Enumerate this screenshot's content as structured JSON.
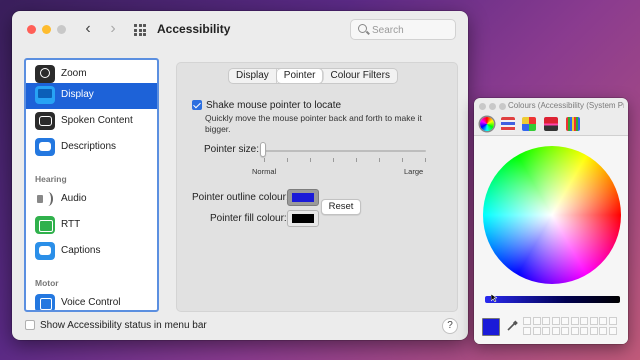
{
  "window": {
    "title": "Accessibility",
    "search_placeholder": "Search"
  },
  "sidebar": {
    "items": [
      {
        "label": "Zoom",
        "icon": "magnifier-icon"
      },
      {
        "label": "Display",
        "icon": "display-icon",
        "selected": true
      },
      {
        "label": "Spoken Content",
        "icon": "speech-bubble-icon"
      },
      {
        "label": "Descriptions",
        "icon": "descriptions-icon"
      }
    ],
    "hearing_header": "Hearing",
    "hearing_items": [
      {
        "label": "Audio",
        "icon": "speaker-icon"
      },
      {
        "label": "RTT",
        "icon": "rtt-icon"
      },
      {
        "label": "Captions",
        "icon": "captions-icon"
      }
    ],
    "motor_header": "Motor",
    "motor_items": [
      {
        "label": "Voice Control",
        "icon": "voice-control-icon"
      }
    ]
  },
  "tabs": [
    {
      "label": "Display"
    },
    {
      "label": "Pointer",
      "active": true
    },
    {
      "label": "Colour Filters"
    }
  ],
  "pointer": {
    "shake_label": "Shake mouse pointer to locate",
    "shake_checked": true,
    "shake_description": "Quickly move the mouse pointer back and forth to make it bigger.",
    "size_label": "Pointer size:",
    "size_min_label": "Normal",
    "size_max_label": "Large",
    "size_value": 0,
    "outline_label": "Pointer outline colour:",
    "outline_color": "#1a1ad8",
    "fill_label": "Pointer fill colour:",
    "fill_color": "#000000",
    "reset_label": "Reset"
  },
  "footer": {
    "status_label": "Show Accessibility status in menu bar",
    "status_checked": false,
    "help_label": "?"
  },
  "colours_window": {
    "title": "Colours (Accessibility (System Preferences))",
    "selected_color": "#1a1ad8"
  },
  "colors": {
    "accent": "#1d62d8"
  }
}
